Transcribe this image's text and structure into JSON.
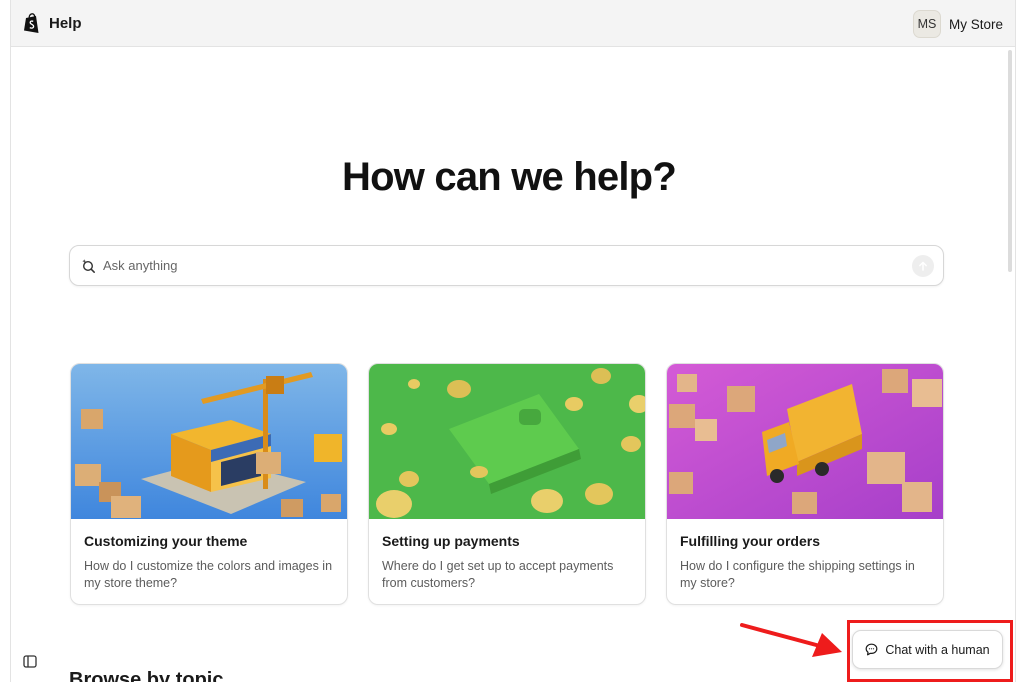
{
  "header": {
    "title": "Help",
    "avatar_initials": "MS",
    "store_name": "My Store"
  },
  "hero": {
    "title": "How can we help?"
  },
  "search": {
    "placeholder": "Ask anything",
    "value": "",
    "icon": "search-sparkle-icon",
    "submit_icon": "arrow-up-icon"
  },
  "cards": [
    {
      "title": "Customizing your theme",
      "description": "How do I customize the colors and images in my store theme?",
      "image": "storefront-construction-illustration"
    },
    {
      "title": "Setting up payments",
      "description": "Where do I get set up to accept payments from customers?",
      "image": "wallet-coins-illustration"
    },
    {
      "title": "Fulfilling your orders",
      "description": "How do I configure the shipping settings in my store?",
      "image": "delivery-truck-boxes-illustration"
    }
  ],
  "section": {
    "title": "Browse by topic"
  },
  "chat": {
    "label": "Chat with a human",
    "icon": "chat-bubble-icon"
  },
  "annotation": {
    "highlight_color": "#ee1c1c"
  },
  "colors": {
    "header_bg": "#f4f4f4",
    "page_bg": "#ffffff",
    "brand": "#111111"
  }
}
